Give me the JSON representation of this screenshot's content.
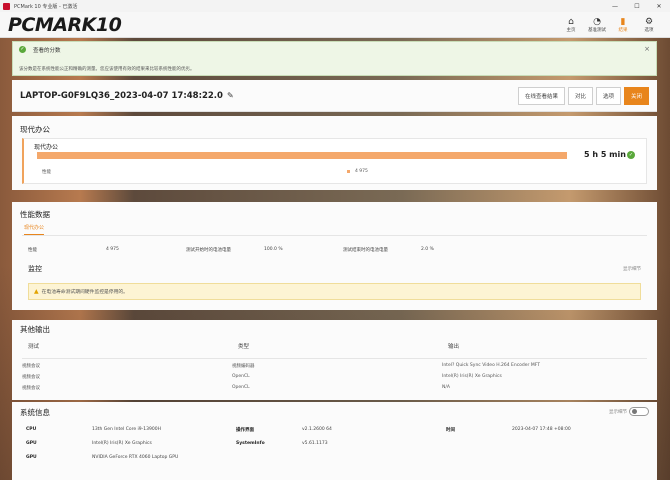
{
  "window": {
    "title": "PCMark 10 专业版 - 已激活",
    "controls": [
      "—",
      "☐",
      "✕"
    ]
  },
  "header": {
    "logo": "PCMARK",
    "logo_num": "10",
    "nav": [
      {
        "label": "主页",
        "icon": "home-icon",
        "glyph": "⌂"
      },
      {
        "label": "基准测试",
        "icon": "gauge-icon",
        "glyph": "◔"
      },
      {
        "label": "结果",
        "icon": "bar-chart-icon",
        "glyph": "▮"
      },
      {
        "label": "选项",
        "icon": "gear-icon",
        "glyph": "⚙"
      }
    ],
    "active_nav": 2
  },
  "banner": {
    "title": "查看的分数",
    "text": "该分数是在系统性能公正和精确的测量。您应该使用有效的结果来比较系统性能的优劣。",
    "close": "×"
  },
  "result": {
    "name": "LAPTOP-G0F9LQ36_2023-04-07 17:48:22.0",
    "buttons": {
      "online": "在线查看结果",
      "compare": "对比",
      "options": "选项",
      "close": "关闭"
    }
  },
  "modern_office": {
    "title": "现代办公",
    "card_title": "现代办公",
    "duration": "5 h 5 min",
    "progress": 1.0,
    "metric_label": "性能",
    "metric_value": "4 975"
  },
  "perf_data": {
    "title": "性能数据",
    "tab": "现代办公",
    "row": [
      {
        "label": "性能",
        "value": "4 975"
      },
      {
        "label": "测试开始时的电池电量",
        "value": "100.0 %"
      },
      {
        "label": "测试结束时的电池电量",
        "value": "2.0 %"
      }
    ],
    "monitor_title": "监控",
    "monitor_link": "显示细节",
    "warning": "在电池寿命测试期间硬件监控是停用的。"
  },
  "other_output": {
    "title": "其他输出",
    "headers": [
      "测试",
      "类型",
      "输出"
    ],
    "rows": [
      [
        "视频会议",
        "视频编码器",
        "Intel? Quick Sync Video H.264 Encoder MFT"
      ],
      [
        "视频会议",
        "OpenCL",
        "Intel(R) Iris(R) Xe Graphics"
      ],
      [
        "视频会议",
        "OpenCL",
        "N/A"
      ]
    ]
  },
  "system_info": {
    "title": "系统信息",
    "toggle_label": "显示细节",
    "rows": [
      [
        {
          "k": "CPU",
          "v": "13th Gen Intel Core i9-13900H"
        },
        {
          "k": "操作界面",
          "v": "v2.1.2600 64"
        },
        {
          "k": "时间",
          "v": "2023-04-07 17:48 +08:00"
        }
      ],
      [
        {
          "k": "GPU",
          "v": "Intel(R) Iris(R) Xe Graphics"
        },
        {
          "k": "SystemInfo",
          "v": "v5.61.1173"
        }
      ],
      [
        {
          "k": "GPU",
          "v": "NVIDIA GeForce RTX 4060 Laptop GPU"
        }
      ]
    ]
  },
  "colors": {
    "accent": "#e8851c",
    "bar": "#f4a86b",
    "success": "#5aa83b"
  }
}
